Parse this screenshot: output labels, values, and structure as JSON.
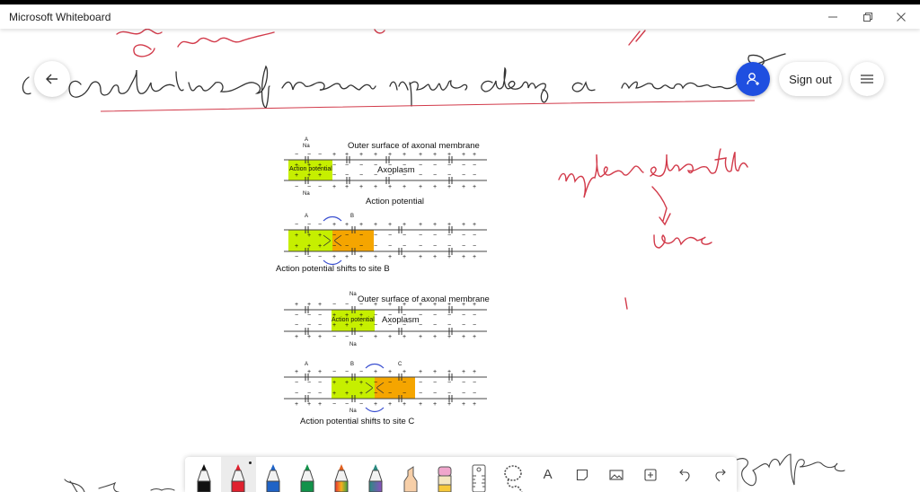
{
  "window": {
    "title": "Microsoft Whiteboard",
    "controls": {
      "minimize": "minimize",
      "restore": "restore",
      "close": "close"
    }
  },
  "header": {
    "back_icon": "arrow-left-icon",
    "invite_icon": "add-person-icon",
    "sign_out_label": "Sign out",
    "menu_icon": "hamburger-menu-icon",
    "accent_color": "#1f4fe0"
  },
  "handwriting": {
    "heading": "Conduction of nerve impulse along a nerve fibre",
    "side_note_1": "myelin sheath",
    "side_note_2": "bone",
    "bottom_note": "synapse",
    "ink_colors": {
      "black": "#333333",
      "red": "#d23a4a"
    }
  },
  "diagram": {
    "panel1": {
      "label_outer": "Outer surface of axonal membrane",
      "label_action_box": "Action potential",
      "label_axoplasm": "Axoplasm",
      "label_caption": "Action potential",
      "site_a": "A",
      "na": "Na"
    },
    "panel2": {
      "site_a": "A",
      "site_b": "B",
      "caption": "Action potential shifts to site B"
    },
    "panel3": {
      "label_outer": "Outer surface of axonal membrane",
      "label_action_box": "Action potential",
      "label_axoplasm": "Axoplasm",
      "na": "Na"
    },
    "panel4": {
      "site_a": "A",
      "site_b": "B",
      "site_c": "C",
      "na": "Na",
      "caption": "Action potential shifts to site C"
    },
    "colors": {
      "active": "#c6ef00",
      "shifting": "#f5a500",
      "arrow": "#3a4fd0"
    }
  },
  "toolbar": {
    "tools": [
      {
        "name": "black-pen",
        "color": "#111111",
        "selected": false
      },
      {
        "name": "red-pen",
        "color": "#e0202e",
        "selected": true
      },
      {
        "name": "blue-pen",
        "color": "#1f63c6",
        "selected": false
      },
      {
        "name": "green-pen",
        "color": "#12924a",
        "selected": false
      },
      {
        "name": "rainbow-pen",
        "color": "#e06020",
        "selected": false
      },
      {
        "name": "galaxy-pen",
        "color": "#2a8a80",
        "selected": false
      },
      {
        "name": "highlighter",
        "color": "#f7c9a0",
        "selected": false
      },
      {
        "name": "eraser",
        "color": "#f0a0c8",
        "selected": false
      },
      {
        "name": "ruler",
        "selected": false
      },
      {
        "name": "lasso-select",
        "selected": false
      },
      {
        "name": "text",
        "label": "A",
        "selected": false
      },
      {
        "name": "sticky-note",
        "selected": false
      },
      {
        "name": "insert-image",
        "selected": false
      },
      {
        "name": "insert-more",
        "selected": false
      },
      {
        "name": "undo",
        "selected": false
      },
      {
        "name": "redo",
        "selected": false
      }
    ]
  }
}
